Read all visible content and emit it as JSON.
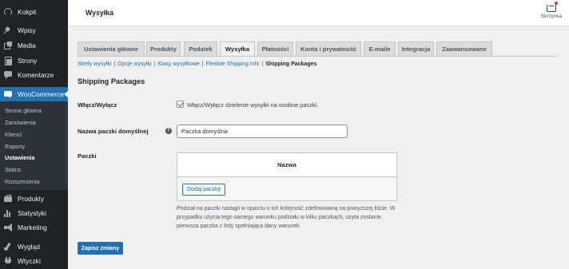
{
  "page_title": "Wysyłka",
  "inbox_label": "Skrzynka",
  "sidebar": {
    "items": [
      {
        "label": "Kokpit",
        "icon": "dashboard-icon"
      },
      {
        "label": "Wpisy",
        "icon": "pin-icon"
      },
      {
        "label": "Media",
        "icon": "media-icon"
      },
      {
        "label": "Strony",
        "icon": "pages-icon"
      },
      {
        "label": "Komentarze",
        "icon": "comments-icon"
      },
      {
        "label": "WooCommerce",
        "icon": "woocommerce-icon"
      },
      {
        "label": "Produkty",
        "icon": "products-icon"
      },
      {
        "label": "Statystyki",
        "icon": "stats-icon"
      },
      {
        "label": "Marketing",
        "icon": "megaphone-icon"
      },
      {
        "label": "Wygląd",
        "icon": "brush-icon"
      },
      {
        "label": "Wtyczki",
        "icon": "plugin-icon"
      }
    ],
    "submenu": [
      "Strona główna",
      "Zamówienia",
      "Klienci",
      "Raporty",
      "Ustawienia",
      "Status",
      "Rozszerzenia"
    ],
    "active_submenu": "Ustawienia"
  },
  "tabs": [
    "Ustawienia główne",
    "Produkty",
    "Podatek",
    "Wysyłka",
    "Płatności",
    "Konta i prywatność",
    "E-maile",
    "Integracja",
    "Zaawansowane"
  ],
  "active_tab": "Wysyłka",
  "subnav": {
    "links": [
      "Strefy wysyłki",
      "Opcje wysyłki",
      "Klasy wysyłkowe",
      "Flexible Shipping Info"
    ],
    "separator": "|",
    "current": "Shipping Packages"
  },
  "section_title": "Shipping Packages",
  "fields": {
    "enable_label": "Włącz/Wyłącz",
    "enable_checkbox_label": "Włącz/Wyłącz dzielenie wysyłki na osobne paczki.",
    "enable_checked": true,
    "default_name_label": "Nazwa paczki domyślnej",
    "help_icon": "?",
    "default_name_value": "Paczka domyślna",
    "packages_label": "Paczki",
    "packages_column_header": "Nazwa",
    "add_package_label": "Dodaj paczkę",
    "packages_description": "Podział na paczki nastąpi w oparciu o ich kolejność zdefiniowaną na powyższej liście. W przypadku użycia tego samego warunku podziału w kilku paczkach, użyta zostanie pierwsza paczka z listy spełniająca dany warunek."
  },
  "save_label": "Zapisz zmiany",
  "colors": {
    "sidebar_bg": "#1d2327",
    "accent": "#2271b1",
    "background": "#f0f0f1"
  }
}
